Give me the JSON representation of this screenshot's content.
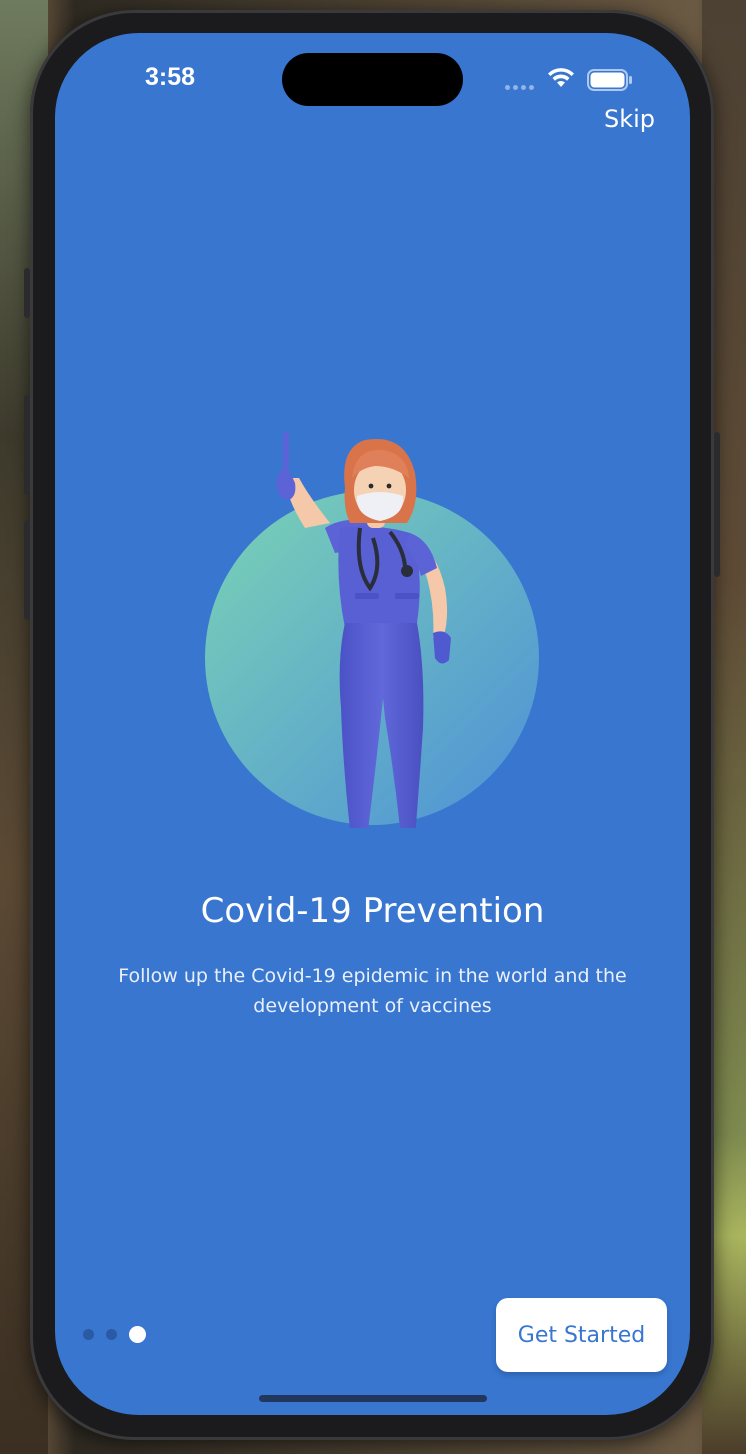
{
  "status_bar": {
    "time": "3:58"
  },
  "header": {
    "skip_label": "Skip"
  },
  "onboarding": {
    "title": "Covid-19 Prevention",
    "description": "Follow up the Covid-19 epidemic in the world and the development of vaccines",
    "page_count": 3,
    "current_page": 3
  },
  "actions": {
    "get_started_label": "Get Started"
  },
  "colors": {
    "screen_background": "#3876d0",
    "button_text": "#3876d0",
    "circle_gradient_start": "#7ad3b5",
    "circle_gradient_end": "#4e90d8",
    "scrubs": "#5b63d6"
  },
  "icons": [
    "wifi-icon",
    "battery-icon",
    "nurse-illustration"
  ]
}
